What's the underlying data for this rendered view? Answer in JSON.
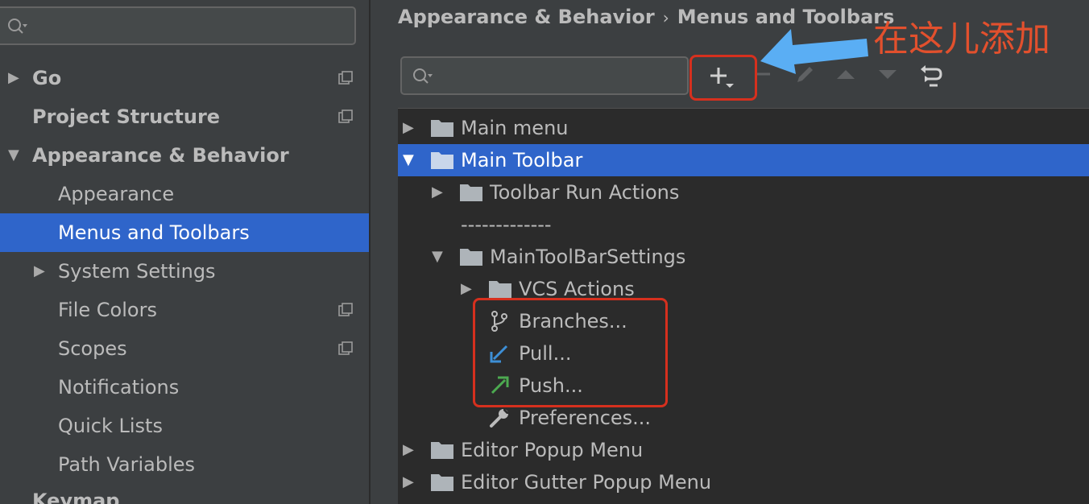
{
  "sidebar": {
    "search_placeholder": "",
    "items": [
      {
        "label": "Go",
        "expander": "▶",
        "has_copy_icon": true
      },
      {
        "label": "Project Structure",
        "has_copy_icon": true
      },
      {
        "label": "Appearance & Behavior",
        "expander": "▼"
      },
      {
        "label": "Appearance"
      },
      {
        "label": "Menus and Toolbars",
        "selected": true
      },
      {
        "label": "System Settings",
        "expander": "▶"
      },
      {
        "label": "File Colors",
        "has_copy_icon": true
      },
      {
        "label": "Scopes",
        "has_copy_icon": true
      },
      {
        "label": "Notifications"
      },
      {
        "label": "Quick Lists"
      },
      {
        "label": "Path Variables"
      },
      {
        "label": "Keymap"
      }
    ]
  },
  "breadcrumb": {
    "parent": "Appearance & Behavior",
    "separator": "›",
    "current": "Menus and Toolbars"
  },
  "toolbar": {
    "search_placeholder": "",
    "buttons": [
      "add-icon",
      "remove-icon",
      "edit-icon",
      "move-up-icon",
      "move-down-icon",
      "restore-icon"
    ]
  },
  "tree": {
    "rows": [
      {
        "label": "Main menu",
        "expander": "▶",
        "icon": "folder-icon"
      },
      {
        "label": "Main Toolbar",
        "expander": "▼",
        "icon": "folder-icon",
        "selected": true
      },
      {
        "label": "Toolbar Run Actions",
        "expander": "▶",
        "icon": "folder-icon"
      },
      {
        "label": "-------------"
      },
      {
        "label": "MainToolBarSettings",
        "expander": "▼",
        "icon": "folder-icon"
      },
      {
        "label": "VCS Actions",
        "expander": "▶",
        "icon": "folder-icon"
      },
      {
        "label": "Branches...",
        "icon": "branch-icon"
      },
      {
        "label": "Pull...",
        "icon": "pull-arrow-icon"
      },
      {
        "label": "Push...",
        "icon": "push-arrow-icon"
      },
      {
        "label": "Preferences...",
        "icon": "wrench-icon"
      },
      {
        "label": "Editor Popup Menu",
        "expander": "▶",
        "icon": "folder-icon"
      },
      {
        "label": "Editor Gutter Popup Menu",
        "expander": "▶",
        "icon": "folder-icon"
      }
    ]
  },
  "annotation": {
    "text": "在这儿添加",
    "color": "#e2502d",
    "arrow_color": "#5aaef4",
    "box_color": "#d6301e"
  },
  "colors": {
    "selection": "#2f65ca",
    "panel_bg": "#3c3f41",
    "tree_bg": "#2b2b2b",
    "text": "#bbbbbb"
  }
}
